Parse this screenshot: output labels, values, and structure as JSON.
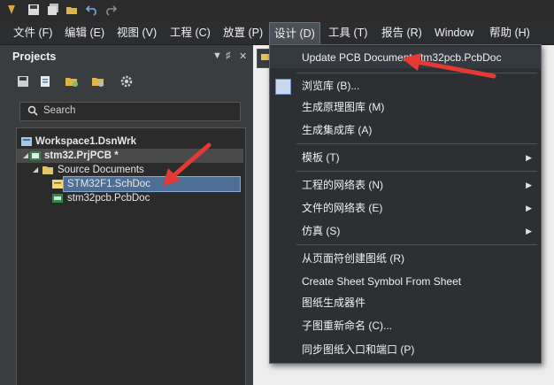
{
  "toolbar": {
    "icons": [
      "app-logo-icon",
      "save-icon",
      "save-all-icon",
      "open-folder-icon",
      "undo-icon",
      "redo-icon"
    ]
  },
  "menubar": {
    "items": [
      {
        "label": "文件 (F)"
      },
      {
        "label": "编辑 (E)"
      },
      {
        "label": "视图 (V)"
      },
      {
        "label": "工程 (C)"
      },
      {
        "label": "放置 (P)"
      },
      {
        "label": "设计 (D)"
      },
      {
        "label": "工具 (T)"
      },
      {
        "label": "报告 (R)"
      },
      {
        "label": "Window"
      },
      {
        "label": "帮助 (H)"
      }
    ]
  },
  "panel": {
    "title": "Projects",
    "controls": [
      "▼",
      "♯",
      "✕"
    ],
    "search_label": "Search"
  },
  "tree": {
    "workspace": "Workspace1.DsnWrk",
    "project": "stm32.PrjPCB *",
    "folder": "Source Documents",
    "doc1": "STM32F1.SchDoc",
    "doc2": "stm32pcb.PcbDoc"
  },
  "design_menu": {
    "items": [
      {
        "label": "Update PCB Document stm32pcb.PcbDoc"
      },
      {
        "label": "浏览库 (B)..."
      },
      {
        "label": "生成原理图库 (M)"
      },
      {
        "label": "生成集成库 (A)"
      },
      {
        "label": "模板 (T)"
      },
      {
        "label": "工程的网络表 (N)"
      },
      {
        "label": "文件的网络表 (E)"
      },
      {
        "label": "仿真 (S)"
      },
      {
        "label": "从页面符创建图纸 (R)"
      },
      {
        "label": "Create Sheet Symbol From Sheet"
      },
      {
        "label": "图纸生成器件"
      },
      {
        "label": "子图重新命名 (C)..."
      },
      {
        "label": "同步图纸入口和端口 (P)"
      }
    ]
  },
  "colors": {
    "annotation_arrow": "#e53935",
    "selection": "#4d6f95",
    "menu_bg": "#2d3033"
  }
}
